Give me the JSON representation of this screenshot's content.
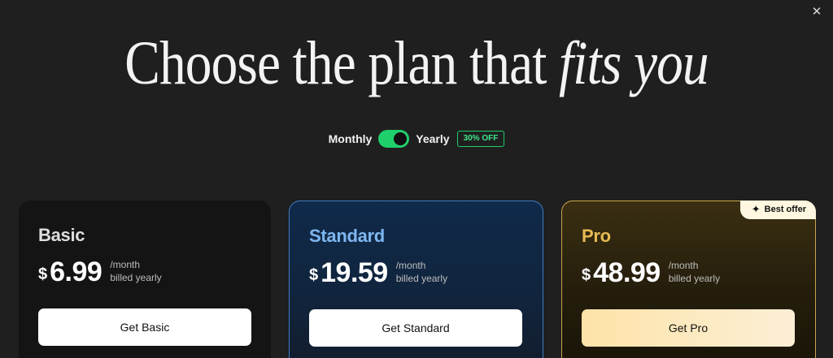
{
  "close_label": "✕",
  "headline": {
    "regular": "Choose the plan that",
    "italic": "fits you"
  },
  "billing": {
    "monthly_label": "Monthly",
    "yearly_label": "Yearly",
    "discount_badge": "30% OFF",
    "yearly_selected": true,
    "toggle_color": "#1fcf6b"
  },
  "plans": [
    {
      "name": "Basic",
      "currency": "$",
      "price": "6.99",
      "period_line1": "/month",
      "period_line2": "billed yearly",
      "cta": "Get Basic",
      "name_color": "#dedede"
    },
    {
      "name": "Standard",
      "currency": "$",
      "price": "19.59",
      "period_line1": "/month",
      "period_line2": "billed yearly",
      "cta": "Get Standard",
      "name_color": "#7eb6f0"
    },
    {
      "name": "Pro",
      "currency": "$",
      "price": "48.99",
      "period_line1": "/month",
      "period_line2": "billed yearly",
      "cta": "Get Pro",
      "badge": "Best offer",
      "badge_icon": "sparkle-icon",
      "name_color": "#e7bb52"
    }
  ]
}
